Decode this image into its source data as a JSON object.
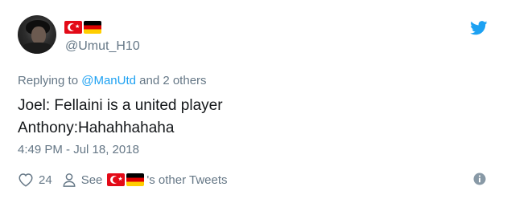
{
  "tweet": {
    "handle": "@Umut_H10",
    "replying_prefix": "Replying to",
    "replying_mention": "@ManUtd",
    "replying_suffix": "and 2 others",
    "lines": [
      "Joel: Fellaini is a united player",
      "Anthony:Hahahhahaha"
    ],
    "timestamp": "4:49 PM - Jul 18, 2018",
    "like_count": "24",
    "see_prefix": "See",
    "see_suffix": "'s other Tweets",
    "name_flags": [
      "turkey-flag-icon",
      "germany-flag-icon"
    ]
  },
  "colors": {
    "twitter_blue": "#1da1f2",
    "secondary_text": "#657786",
    "primary_text": "#14171a"
  },
  "icons": {
    "brand": "twitter-bird-icon",
    "like": "heart-icon",
    "profile": "person-icon",
    "info": "info-icon"
  }
}
